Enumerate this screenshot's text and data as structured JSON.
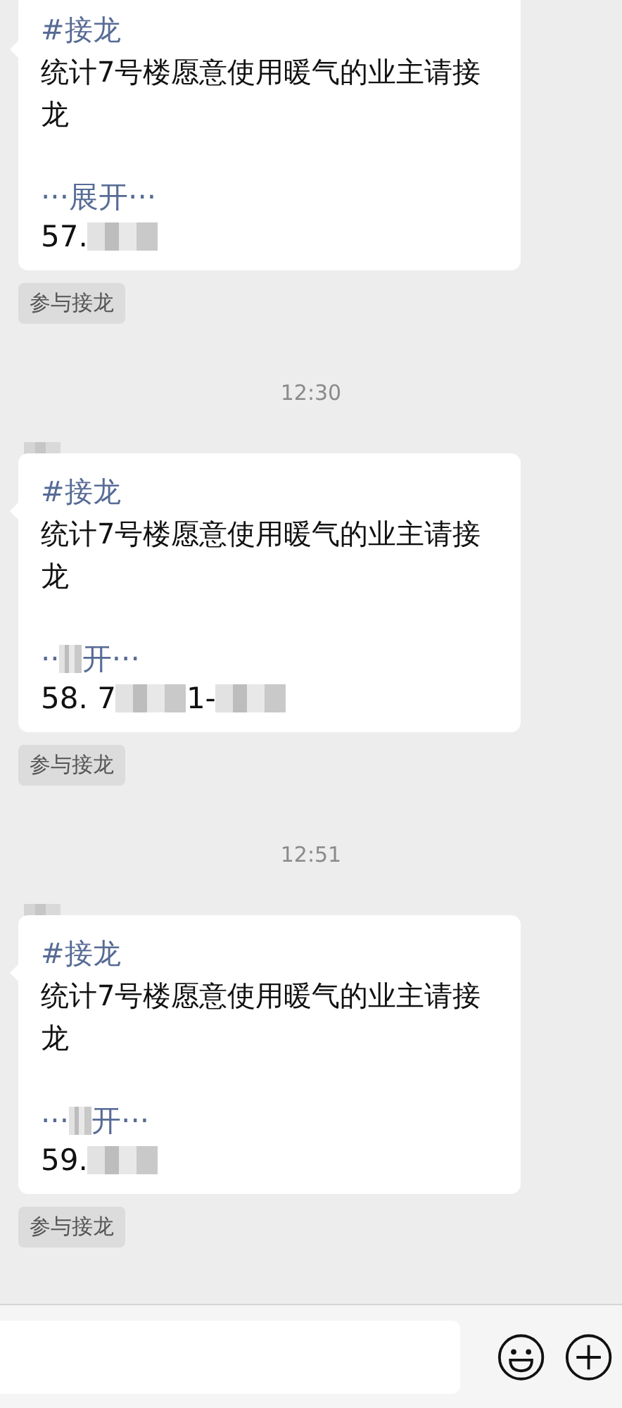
{
  "messages": [
    {
      "sender_redacted": false,
      "tag": "#接龙",
      "text": "统计7号楼愿意使用暖气的业主请接龙",
      "expand_parts": [
        {
          "kind": "text",
          "text": "···展开···"
        }
      ],
      "number_parts": [
        {
          "kind": "text",
          "text": "57."
        },
        {
          "kind": "redacted"
        }
      ],
      "action": "参与接龙"
    },
    {
      "time": "12:30",
      "sender_redacted": true,
      "tag": "#接龙",
      "text": "统计7号楼愿意使用暖气的业主请接龙",
      "expand_parts": [
        {
          "kind": "text",
          "text": "··"
        },
        {
          "kind": "redacted"
        },
        {
          "kind": "text",
          "text": "开···"
        }
      ],
      "number_parts": [
        {
          "kind": "text",
          "text": "58. 7"
        },
        {
          "kind": "redacted"
        },
        {
          "kind": "text",
          "text": "1-"
        },
        {
          "kind": "redacted"
        }
      ],
      "action": "参与接龙"
    },
    {
      "time": "12:51",
      "sender_redacted": true,
      "tag": "#接龙",
      "text": "统计7号楼愿意使用暖气的业主请接龙",
      "expand_parts": [
        {
          "kind": "text",
          "text": "···"
        },
        {
          "kind": "redacted"
        },
        {
          "kind": "text",
          "text": "开···"
        }
      ],
      "number_parts": [
        {
          "kind": "text",
          "text": "59."
        },
        {
          "kind": "redacted"
        }
      ],
      "action": "参与接龙"
    }
  ]
}
